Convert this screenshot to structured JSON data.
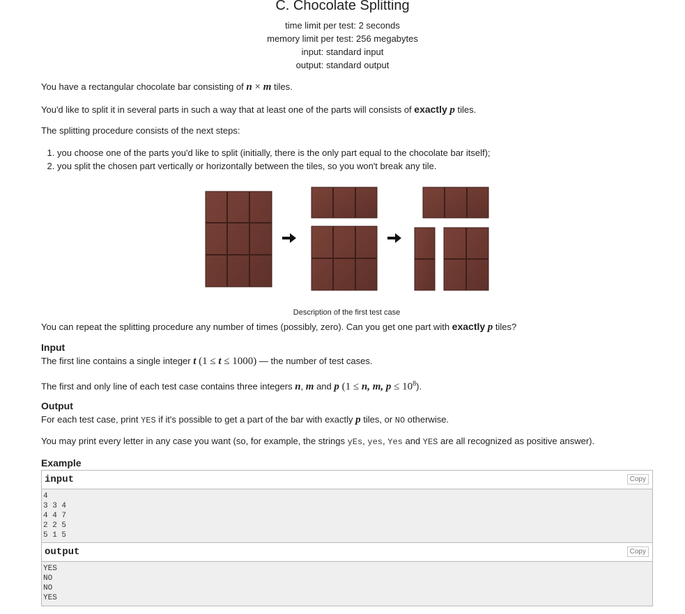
{
  "problem": {
    "title": "C. Chocolate Splitting",
    "time_limit": "time limit per test: 2 seconds",
    "memory_limit": "memory limit per test: 256 megabytes",
    "input": "input: standard input",
    "output": "output: standard output"
  },
  "statement": {
    "p1_a": "You have a rectangular chocolate bar consisting of ",
    "p1_n": "n",
    "p1_x": " × ",
    "p1_m": "m",
    "p1_b": " tiles.",
    "p2_a": "You'd like to split it in several parts in such a way that at least one of the parts will consists of ",
    "p2_exactly": "exactly",
    "p2_p": "p",
    "p2_b": " tiles.",
    "p3": "The splitting procedure consists of the next steps:",
    "steps": [
      "you choose one of the parts you'd like to split (initially, there is the only part equal to the chocolate bar itself);",
      "you split the chosen part vertically or horizontally between the tiles, so you won't break any tile."
    ],
    "caption": "Description of the first test case",
    "p4_a": "You can repeat the splitting procedure any number of times (possibly, zero). Can you get one part with ",
    "p4_exactly": "exactly",
    "p4_p": "p",
    "p4_b": " tiles?"
  },
  "input_section": {
    "heading": "Input",
    "l1_a": "The first line contains a single integer ",
    "l1_t": "t",
    "l1_range": " (1 ≤ ",
    "l1_t2": "t",
    "l1_range2": " ≤ 1000)",
    "l1_b": " — the number of test cases.",
    "l2_a": "The first and only line of each test case contains three integers ",
    "l2_n": "n",
    "l2_c1": ", ",
    "l2_m": "m",
    "l2_and": " and ",
    "l2_p": "p",
    "l2_range": " (1 ≤ ",
    "l2_vars": "n, m, p",
    "l2_range2": " ≤ 10",
    "l2_exp": "8",
    "l2_b": ")."
  },
  "output_section": {
    "heading": "Output",
    "l1_a": "For each test case, print ",
    "l1_yes": "YES",
    "l1_b": " if it's possible to get a part of the bar with exactly ",
    "l1_p": "p",
    "l1_c": " tiles, or ",
    "l1_no": "NO",
    "l1_d": " otherwise.",
    "l2_a": "You may print every letter in any case you want (so, for example, the strings ",
    "l2_s1": "yEs",
    "l2_c1": ", ",
    "l2_s2": "yes",
    "l2_c2": ", ",
    "l2_s3": "Yes",
    "l2_and": " and ",
    "l2_s4": "YES",
    "l2_b": " are all recognized as positive answer)."
  },
  "example": {
    "heading": "Example",
    "input_label": "input",
    "output_label": "output",
    "copy_label": "Copy",
    "input_lines": [
      "4",
      "3 3 4",
      "4 4 7",
      "2 2 5",
      "5 1 5"
    ],
    "output_lines": [
      "YES",
      "NO",
      "NO",
      "YES"
    ]
  },
  "colors": {
    "chocolate": "#6e3b33",
    "chocolate_dark": "#4a241e",
    "sample_bg": "#efefef"
  }
}
